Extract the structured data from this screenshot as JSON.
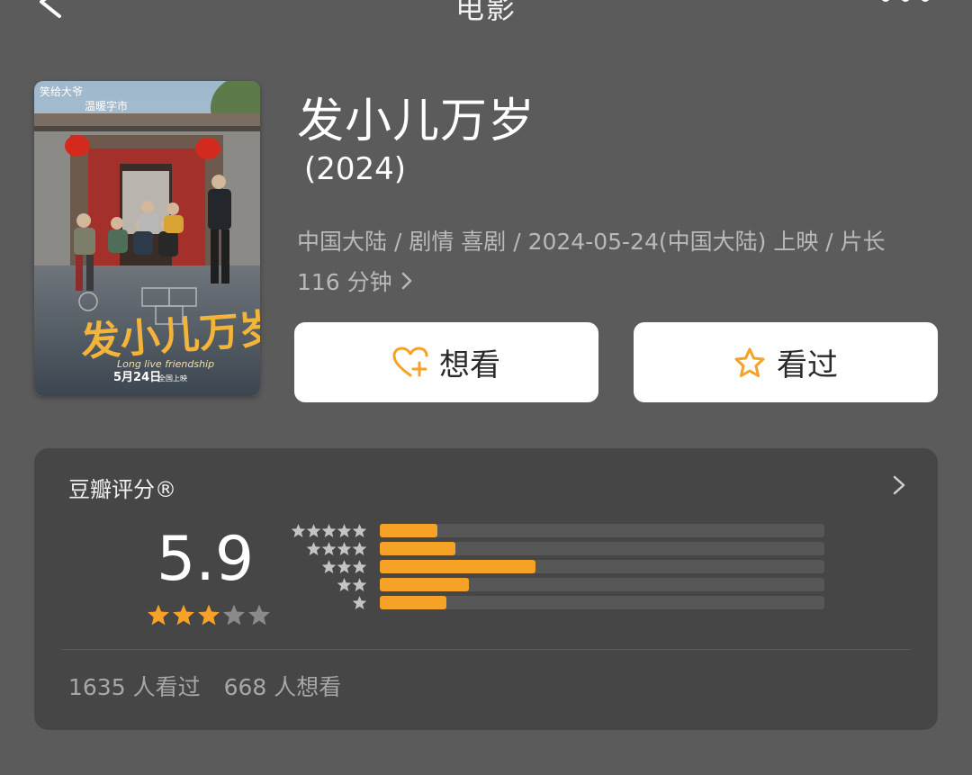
{
  "nav": {
    "title": "电影",
    "back_icon": "chevron-left-icon",
    "more_icon": "more-dots-icon"
  },
  "poster": {
    "title_art": "发小儿万岁",
    "slogan_1": "笑给大爷",
    "slogan_2": "温暖字市",
    "english": "Long live friendship",
    "date": "5月24日",
    "release_note": "全国上映"
  },
  "movie": {
    "title": "发小儿万岁",
    "year": "(2024)",
    "meta_line_1": "中国大陆 / 剧情 喜剧 / 2024-05-24(中国大陆) 上映 / 片长",
    "meta_line_2": "116 分钟"
  },
  "actions": {
    "want_label": "想看",
    "seen_label": "看过",
    "want_icon": "heart-plus-icon",
    "seen_icon": "star-outline-icon",
    "accent": "#f5a226"
  },
  "rating": {
    "label": "豆瓣评分®",
    "score": "5.9",
    "star_value": 3,
    "star_max": 5,
    "distribution": [
      {
        "stars": 5,
        "fraction": 0.13
      },
      {
        "stars": 4,
        "fraction": 0.17
      },
      {
        "stars": 3,
        "fraction": 0.35
      },
      {
        "stars": 2,
        "fraction": 0.2
      },
      {
        "stars": 1,
        "fraction": 0.15
      }
    ],
    "seen_count": "1635 人看过",
    "want_count": "668 人想看"
  }
}
